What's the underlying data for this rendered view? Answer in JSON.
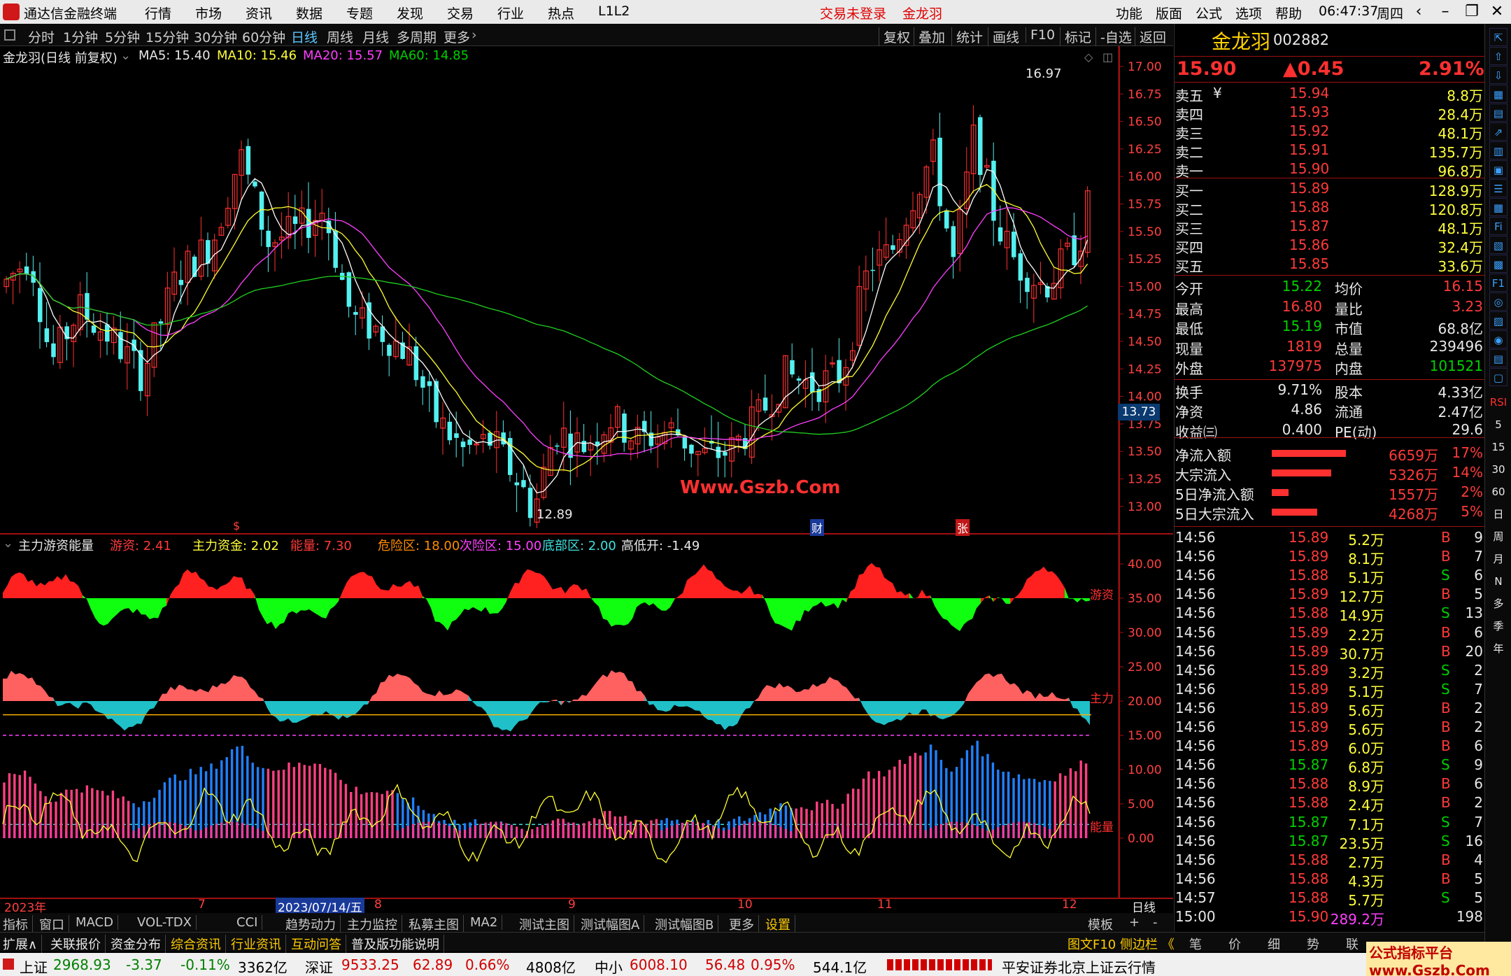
{
  "menubar": {
    "app": "通达信金融终端",
    "items": [
      "行情",
      "市场",
      "资讯",
      "数据",
      "专题",
      "发现",
      "交易",
      "行业",
      "热点",
      "L1L2"
    ],
    "status1": "交易未登录",
    "status2": "金龙羽",
    "right": [
      "功能",
      "版面",
      "公式",
      "选项",
      "帮助"
    ],
    "time": "06:47:37",
    "weekday": "周四"
  },
  "toolbar": {
    "periods": [
      "分时",
      "1分钟",
      "5分钟",
      "15分钟",
      "30分钟",
      "60分钟",
      "日线",
      "周线",
      "月线",
      "多周期",
      "更多"
    ],
    "active": "日线",
    "right": [
      "复权",
      "叠加",
      "统计",
      "画线",
      "F10",
      "标记",
      "-自选",
      "返回"
    ]
  },
  "main_chart": {
    "title": "金龙羽(日线 前复权)",
    "ma5": "MA5: 15.40",
    "ma10": "MA10: 15.46",
    "ma20": "MA20: 15.57",
    "ma60": "MA60: 14.85",
    "price_ticks": [
      "17.00",
      "16.75",
      "16.50",
      "16.25",
      "16.00",
      "15.75",
      "15.50",
      "15.25",
      "15.00",
      "14.75",
      "14.50",
      "14.25",
      "14.00",
      "13.75",
      "13.50",
      "13.25",
      "13.00"
    ],
    "high_label": "16.97",
    "low_label": "12.89",
    "current_box": "13.73",
    "watermark": "Www.Gszb.Com",
    "markers": [
      "$",
      "财",
      "张"
    ]
  },
  "indicator": {
    "title": "主力游资能量",
    "youzi": "游资: 2.41",
    "zhuli": "主力资金: 2.02",
    "nengliang": "能量: 7.30",
    "danger": "危险区: 18.00",
    "secondary": "次险区: 15.00",
    "bottom": "底部区: 2.00",
    "gapopen": "高低开: -1.49",
    "ticks": [
      "40.00",
      "35.00",
      "30.00",
      "25.00",
      "20.00",
      "15.00",
      "10.00",
      "5.00",
      "0.00"
    ],
    "label_youzi": "游资",
    "label_zhuli": "主力",
    "label_nl": "能量"
  },
  "xaxis": {
    "labels": [
      "2023年",
      "7",
      "2023/07/14/五",
      "8",
      "9",
      "10",
      "11",
      "12"
    ],
    "right": "日线"
  },
  "stock": {
    "name": "金龙羽",
    "code": "002882",
    "price": "15.90",
    "change": "▲0.45",
    "pct": "2.91%"
  },
  "asks": [
    {
      "label": "卖五",
      "price": "15.94",
      "vol": "8.8万"
    },
    {
      "label": "卖四",
      "price": "15.93",
      "vol": "28.4万"
    },
    {
      "label": "卖三",
      "price": "15.92",
      "vol": "48.1万"
    },
    {
      "label": "卖二",
      "price": "15.91",
      "vol": "135.7万"
    },
    {
      "label": "卖一",
      "price": "15.90",
      "vol": "96.8万"
    }
  ],
  "bids": [
    {
      "label": "买一",
      "price": "15.89",
      "vol": "128.9万"
    },
    {
      "label": "买二",
      "price": "15.88",
      "vol": "120.8万"
    },
    {
      "label": "买三",
      "price": "15.87",
      "vol": "48.1万"
    },
    {
      "label": "买四",
      "price": "15.86",
      "vol": "32.4万"
    },
    {
      "label": "买五",
      "price": "15.85",
      "vol": "33.6万"
    }
  ],
  "stats": [
    [
      "今开",
      "15.22",
      "均价",
      "16.15"
    ],
    [
      "最高",
      "16.80",
      "量比",
      "3.23"
    ],
    [
      "最低",
      "15.19",
      "市值",
      "68.8亿"
    ],
    [
      "现量",
      "1819",
      "总量",
      "239496"
    ],
    [
      "外盘",
      "137975",
      "内盘",
      "101521"
    ],
    [
      "换手",
      "9.71%",
      "股本",
      "4.33亿"
    ],
    [
      "净资",
      "4.86",
      "流通",
      "2.47亿"
    ],
    [
      "收益㈢",
      "0.400",
      "PE(动)",
      "29.6"
    ]
  ],
  "flows": [
    {
      "label": "净流入额",
      "value": "6659万",
      "pct": "17%",
      "bar": 0.9
    },
    {
      "label": "大宗流入",
      "value": "5326万",
      "pct": "14%",
      "bar": 0.72
    },
    {
      "label": "5日净流入额",
      "value": "1557万",
      "pct": "2%",
      "bar": 0.2
    },
    {
      "label": "5日大宗流入",
      "value": "4268万",
      "pct": "5%",
      "bar": 0.55
    }
  ],
  "ticks": [
    [
      "14:56",
      "15.89",
      "5.2万",
      "B",
      "9"
    ],
    [
      "14:56",
      "15.89",
      "8.1万",
      "B",
      "7"
    ],
    [
      "14:56",
      "15.88",
      "5.1万",
      "S",
      "6"
    ],
    [
      "14:56",
      "15.89",
      "12.7万",
      "B",
      "5"
    ],
    [
      "14:56",
      "15.88",
      "14.9万",
      "S",
      "13"
    ],
    [
      "14:56",
      "15.89",
      "2.2万",
      "B",
      "6"
    ],
    [
      "14:56",
      "15.89",
      "30.7万",
      "B",
      "20"
    ],
    [
      "14:56",
      "15.89",
      "3.2万",
      "S",
      "2"
    ],
    [
      "14:56",
      "15.89",
      "5.1万",
      "S",
      "7"
    ],
    [
      "14:56",
      "15.89",
      "5.6万",
      "B",
      "2"
    ],
    [
      "14:56",
      "15.89",
      "5.6万",
      "B",
      "2"
    ],
    [
      "14:56",
      "15.89",
      "6.0万",
      "B",
      "6"
    ],
    [
      "14:56",
      "15.87",
      "6.8万",
      "S",
      "9"
    ],
    [
      "14:56",
      "15.88",
      "8.9万",
      "B",
      "6"
    ],
    [
      "14:56",
      "15.88",
      "2.4万",
      "B",
      "2"
    ],
    [
      "14:56",
      "15.87",
      "7.1万",
      "S",
      "7"
    ],
    [
      "14:56",
      "15.87",
      "23.5万",
      "S",
      "16"
    ],
    [
      "14:56",
      "15.88",
      "2.7万",
      "B",
      "4"
    ],
    [
      "14:56",
      "15.88",
      "4.3万",
      "B",
      "5"
    ],
    [
      "14:57",
      "15.88",
      "5.7万",
      "S",
      "5"
    ],
    [
      "15:00",
      "15.90",
      "289.2万",
      "",
      "198"
    ]
  ],
  "bottom_tabs": [
    "指标",
    "窗口",
    "MACD",
    "VOL-TDX",
    "CCI",
    "趋势动力",
    "主力监控",
    "私募主图",
    "MA2",
    "测试主图",
    "测试幅图A",
    "测试幅图B",
    "更多",
    "设置"
  ],
  "bottom_right": [
    "模板",
    "+",
    "-"
  ],
  "info_tabs": [
    "扩展∧",
    "关联报价",
    "资金分布",
    "综合资讯",
    "行业资讯",
    "互动问答",
    "普及版功能说明"
  ],
  "info_right": "图文F10 侧边栏 《",
  "quote_tabs": [
    "笔",
    "价",
    "细",
    "势",
    "联"
  ],
  "brand": "公式指标平台 www.Gszb.Com",
  "status": {
    "sh_label": "上证",
    "sh": "2968.93",
    "sh_chg": "-3.37",
    "sh_pct": "-0.11%",
    "sh_amt": "3362亿",
    "sz_label": "深证",
    "sz": "9533.25",
    "sz_chg": "62.89",
    "sz_pct": "0.66%",
    "sz_amt": "4808亿",
    "zx_label": "中小",
    "zx": "6008.10",
    "zx_chg": "56.48",
    "zx_pct": "0.95%",
    "zx_amt": "544.1亿",
    "server": "平安证券北京上证云行情"
  },
  "side_icons": [
    "side-icon-1",
    "side-icon-2",
    "side-icon-3"
  ],
  "side_labels": [
    "RSI",
    "5",
    "15",
    "30",
    "60",
    "日",
    "周",
    "月",
    "N",
    "多",
    "季",
    "年"
  ]
}
